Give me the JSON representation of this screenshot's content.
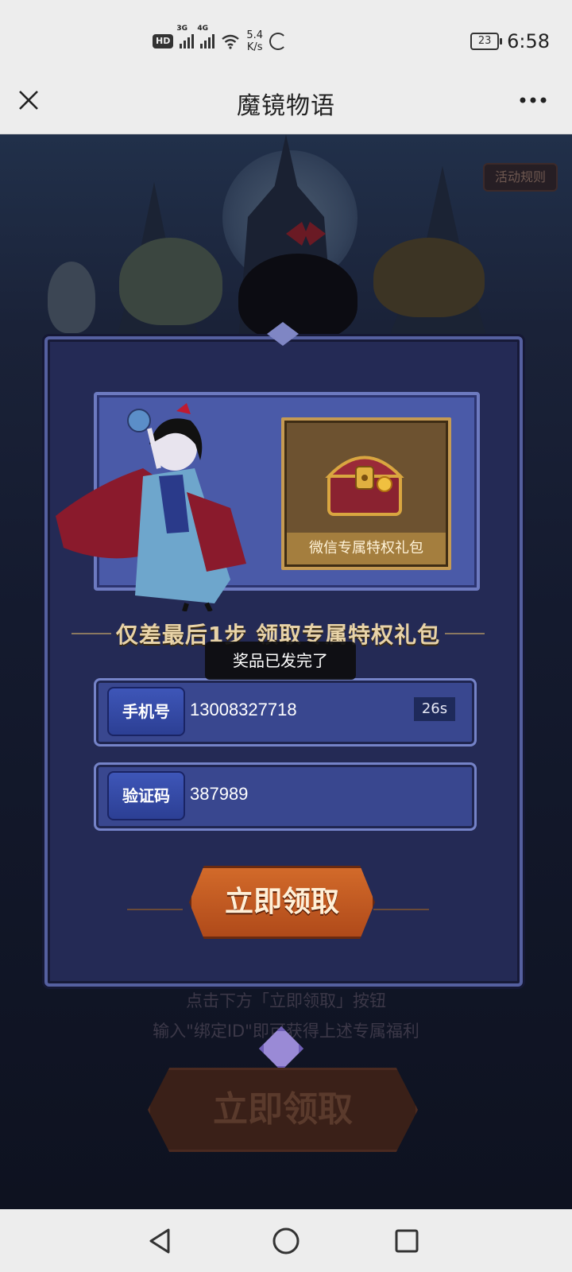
{
  "status_bar": {
    "hd": "HD",
    "network_1": "3G",
    "network_2": "4G",
    "speed_value": "5.4",
    "speed_unit": "K/s",
    "battery": "23",
    "time": "6:58"
  },
  "titlebar": {
    "title": "魔镜物语",
    "close_icon": "close-icon",
    "more_icon": "more-icon"
  },
  "scene": {
    "rules_button": "活动规则"
  },
  "gift": {
    "label": "微信专属特权礼包"
  },
  "headline": "仅差最后1步 领取专属特权礼包",
  "toast": "奖品已发完了",
  "phone_field": {
    "label": "手机号",
    "value": "13008327718",
    "countdown": "26s"
  },
  "code_field": {
    "label": "验证码",
    "value": "387989"
  },
  "claim_button": "立即领取",
  "hint_line_1": "点击下方「立即领取」按钮",
  "hint_line_2": "输入\"绑定ID\"即可获得上述专属福利",
  "claim_button_bottom": "立即领取",
  "nav": {
    "back": "back-icon",
    "home": "home-icon",
    "recents": "recents-icon"
  },
  "colors": {
    "panel": "#242a55",
    "field": "#39478f",
    "button": "#c85a24",
    "headline": "#e8d3a8"
  }
}
